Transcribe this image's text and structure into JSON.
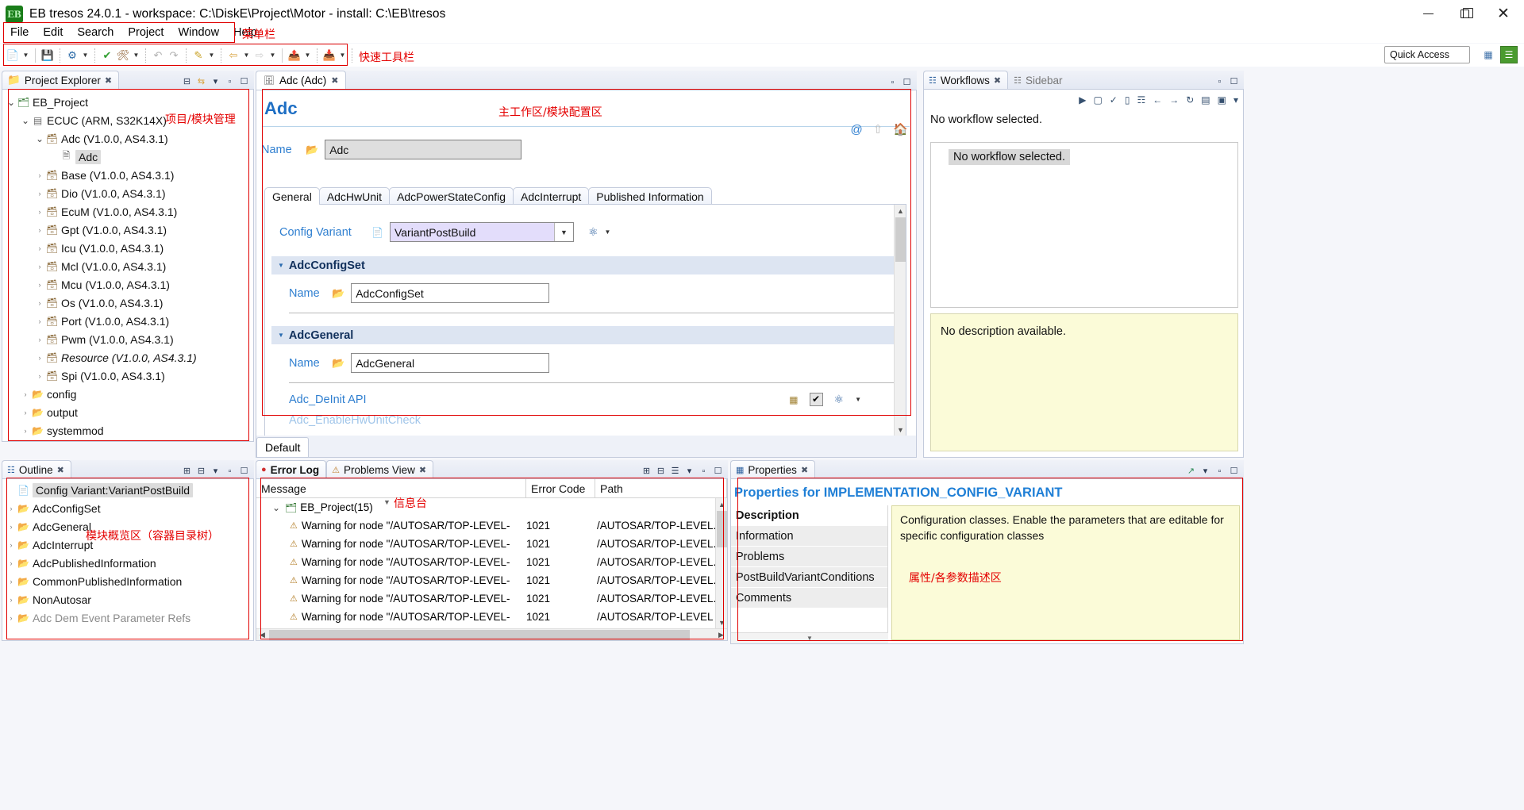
{
  "window": {
    "title": "EB tresos 24.0.1 - workspace: C:\\DiskE\\Project\\Motor - install: C:\\EB\\tresos",
    "logo_text": "EB",
    "minimize": "minimize-button",
    "restore": "restore-button",
    "close": "close-button"
  },
  "menu": {
    "items": [
      "File",
      "Edit",
      "Search",
      "Project",
      "Window",
      "Help"
    ],
    "annotation": "菜单栏"
  },
  "toolbar": {
    "annotation": "快速工具栏",
    "quick_access_placeholder": "Quick Access",
    "quick_access_value": "Quick Access"
  },
  "project_explorer": {
    "tab_label": "Project Explorer",
    "annotation": "项目/模块管理",
    "tree": [
      {
        "label": "EB_Project",
        "depth": 0,
        "twisty": "open",
        "icon": "project-icon"
      },
      {
        "label": "ECUC (ARM, S32K14X)",
        "depth": 1,
        "twisty": "open",
        "icon": "ecu-icon"
      },
      {
        "label": "Adc (V1.0.0, AS4.3.1)",
        "depth": 2,
        "twisty": "open",
        "icon": "module-icon"
      },
      {
        "label": "Adc",
        "depth": 3,
        "twisty": "none",
        "icon": "config-icon",
        "selected": true
      },
      {
        "label": "Base (V1.0.0, AS4.3.1)",
        "depth": 2,
        "twisty": "closed",
        "icon": "module-icon"
      },
      {
        "label": "Dio (V1.0.0, AS4.3.1)",
        "depth": 2,
        "twisty": "closed",
        "icon": "module-icon"
      },
      {
        "label": "EcuM (V1.0.0, AS4.3.1)",
        "depth": 2,
        "twisty": "closed",
        "icon": "module-icon"
      },
      {
        "label": "Gpt (V1.0.0, AS4.3.1)",
        "depth": 2,
        "twisty": "closed",
        "icon": "module-icon"
      },
      {
        "label": "Icu (V1.0.0, AS4.3.1)",
        "depth": 2,
        "twisty": "closed",
        "icon": "module-icon"
      },
      {
        "label": "Mcl (V1.0.0, AS4.3.1)",
        "depth": 2,
        "twisty": "closed",
        "icon": "module-icon"
      },
      {
        "label": "Mcu (V1.0.0, AS4.3.1)",
        "depth": 2,
        "twisty": "closed",
        "icon": "module-icon"
      },
      {
        "label": "Os (V1.0.0, AS4.3.1)",
        "depth": 2,
        "twisty": "closed",
        "icon": "module-icon"
      },
      {
        "label": "Port (V1.0.0, AS4.3.1)",
        "depth": 2,
        "twisty": "closed",
        "icon": "module-icon"
      },
      {
        "label": "Pwm (V1.0.0, AS4.3.1)",
        "depth": 2,
        "twisty": "closed",
        "icon": "module-icon"
      },
      {
        "label": "Resource (V1.0.0, AS4.3.1)",
        "depth": 2,
        "twisty": "closed",
        "icon": "module-icon",
        "italic": true
      },
      {
        "label": "Spi (V1.0.0, AS4.3.1)",
        "depth": 2,
        "twisty": "closed",
        "icon": "module-icon"
      },
      {
        "label": "config",
        "depth": 1,
        "twisty": "closed",
        "icon": "folder-icon"
      },
      {
        "label": "output",
        "depth": 1,
        "twisty": "closed",
        "icon": "folder-icon"
      },
      {
        "label": "systemmod",
        "depth": 1,
        "twisty": "closed",
        "icon": "folder-icon"
      }
    ]
  },
  "editor": {
    "tab_label": "Adc (Adc)",
    "heading": "Adc",
    "annotation": "主工作区/模块配置区",
    "name_label": "Name",
    "name_value": "Adc",
    "tabs": [
      "General",
      "AdcHwUnit",
      "AdcPowerStateConfig",
      "AdcInterrupt",
      "Published Information"
    ],
    "active_tab": "General",
    "config_variant_label": "Config Variant",
    "config_variant_value": "VariantPostBuild",
    "sections": [
      {
        "title": "AdcConfigSet",
        "name_label": "Name",
        "name_value": "AdcConfigSet"
      },
      {
        "title": "AdcGeneral",
        "name_label": "Name",
        "name_value": "AdcGeneral"
      }
    ],
    "api_row_label": "Adc_DeInit API",
    "api_row_label_partial": "Adc_EnableHwUnitCheck",
    "footer_tab": "Default"
  },
  "workflows": {
    "tab_label": "Workflows",
    "tab_inactive_label": "Sidebar",
    "empty_message": "No workflow selected.",
    "selection_chip": "No workflow selected.",
    "description_message": "No description available."
  },
  "outline": {
    "tab_label": "Outline",
    "annotation": "模块概览区（容器目录树）",
    "items": [
      {
        "label": "Config Variant:VariantPostBuild",
        "twisty": "none",
        "icon": "file-icon",
        "selected": true
      },
      {
        "label": "AdcConfigSet",
        "twisty": "closed",
        "icon": "folder-icon"
      },
      {
        "label": "AdcGeneral",
        "twisty": "closed",
        "icon": "folder-icon"
      },
      {
        "label": "AdcInterrupt",
        "twisty": "closed",
        "icon": "folder-icon"
      },
      {
        "label": "AdcPublishedInformation",
        "twisty": "closed",
        "icon": "folder-icon"
      },
      {
        "label": "CommonPublishedInformation",
        "twisty": "closed",
        "icon": "folder-icon"
      },
      {
        "label": "NonAutosar",
        "twisty": "closed",
        "icon": "folder-icon"
      },
      {
        "label": "Adc Dem Event Parameter Refs",
        "twisty": "closed",
        "icon": "folder-icon",
        "dim": true
      }
    ]
  },
  "problems": {
    "tab_error_log": "Error Log",
    "tab_problems_view": "Problems View",
    "annotation": "信息台",
    "columns": [
      "Message",
      "Error Code",
      "Path"
    ],
    "group_row": {
      "label": "EB_Project(15)",
      "twisty": "open"
    },
    "rows": [
      {
        "message": "Warning for node \"/AUTOSAR/TOP-LEVEL-",
        "code": "1021",
        "path": "/AUTOSAR/TOP-LEVEL."
      },
      {
        "message": "Warning for node \"/AUTOSAR/TOP-LEVEL-",
        "code": "1021",
        "path": "/AUTOSAR/TOP-LEVEL."
      },
      {
        "message": "Warning for node \"/AUTOSAR/TOP-LEVEL-",
        "code": "1021",
        "path": "/AUTOSAR/TOP-LEVEL."
      },
      {
        "message": "Warning for node \"/AUTOSAR/TOP-LEVEL-",
        "code": "1021",
        "path": "/AUTOSAR/TOP-LEVEL."
      },
      {
        "message": "Warning for node \"/AUTOSAR/TOP-LEVEL-",
        "code": "1021",
        "path": "/AUTOSAR/TOP-LEVEL."
      },
      {
        "message": "Warning for node \"/AUTOSAR/TOP-LEVEL-",
        "code": "1021",
        "path": "/AUTOSAR/TOP-LEVEL"
      }
    ]
  },
  "properties": {
    "tab_label": "Properties",
    "annotation": "属性/各参数描述区",
    "title": "Properties for IMPLEMENTATION_CONFIG_VARIANT",
    "items": [
      "Description",
      "Information",
      "Problems",
      "PostBuildVariantConditions",
      "Comments"
    ],
    "description_text": "Configuration classes. Enable the parameters that are editable for specific configuration classes"
  },
  "colors": {
    "accent_blue": "#1f6fc4",
    "annotation_red": "#e40000",
    "section_header": "#dde5f2",
    "combo_fill": "#e3ddfb",
    "note_yellow": "#fbfbd8"
  }
}
